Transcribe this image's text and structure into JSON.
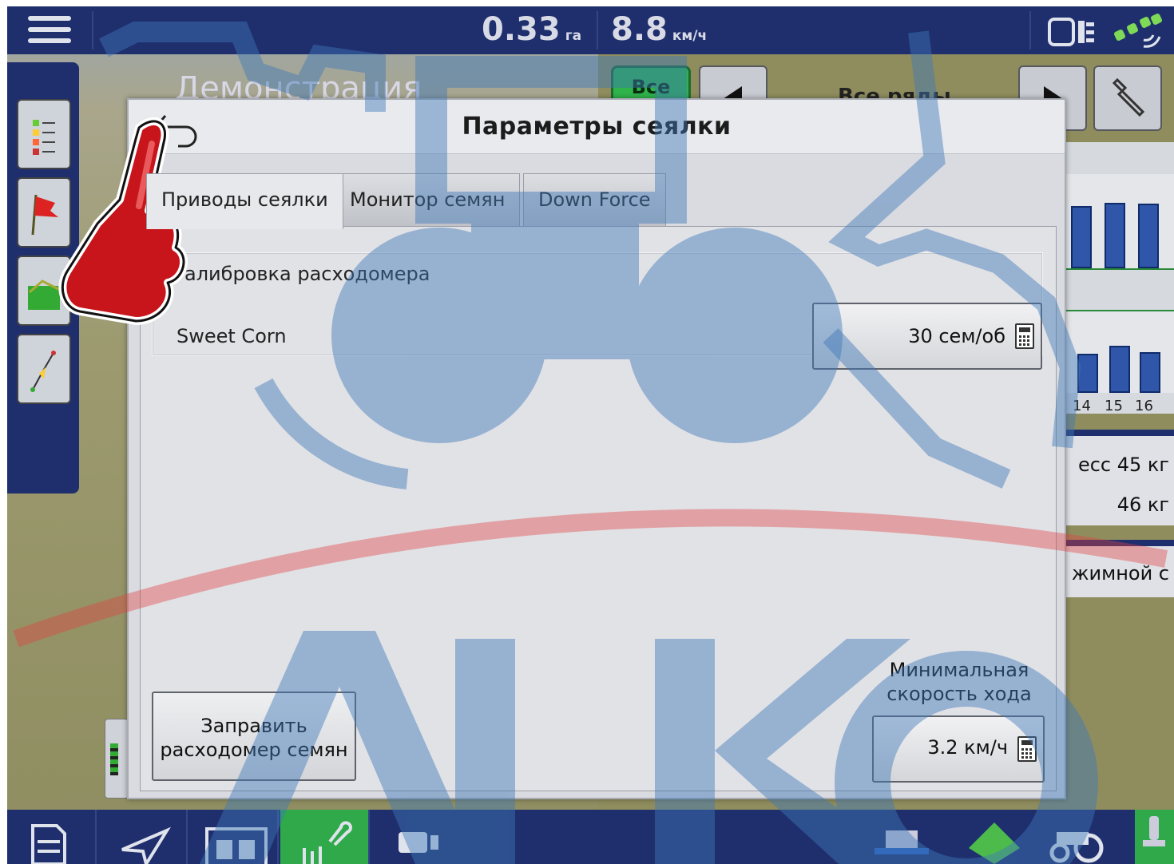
{
  "topbar": {
    "area_value": "0.33",
    "area_unit": "га",
    "speed_value": "8.8",
    "speed_unit": "км/ч",
    "icons": [
      "menu-icon",
      "display-icon",
      "signal-icon"
    ]
  },
  "background": {
    "title": "Демонстрация",
    "all_label": "Все",
    "rows_label": "Все ряды",
    "row_numbers": [
      "14",
      "15",
      "16"
    ],
    "bar_levels": [
      0.55,
      0.58,
      0.57,
      0.4,
      0.48,
      0.42
    ],
    "info1_line1": "есс 45 кг",
    "info1_line2": "46 кг",
    "info2_line1": "жимной с"
  },
  "modal": {
    "title": "Параметры сеялки",
    "tabs": [
      {
        "label": "Приводы сеялки",
        "active": true
      },
      {
        "label": "Монитор семян",
        "active": false
      },
      {
        "label": "Down Force",
        "active": false
      }
    ],
    "calibration_legend": "алибровка расходомера",
    "crop_label": "Sweet Corn",
    "rate_value": "30 сем/об",
    "prime_button_line1": "Заправить",
    "prime_button_line2": "расходомер семян",
    "min_speed_line1": "Минимальная",
    "min_speed_line2": "скорость хода",
    "min_speed_value": "3.2 км/ч"
  },
  "colors": {
    "bar_blue": "#1f2f6e",
    "accent_green": "#2fb34a",
    "watermark_blue": "#3f78b8",
    "watermark_red": "#e04040"
  }
}
